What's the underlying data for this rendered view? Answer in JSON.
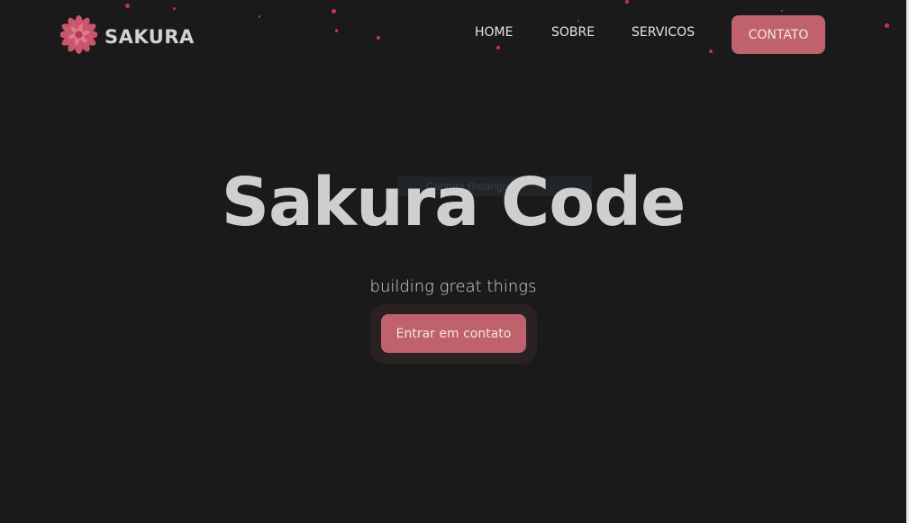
{
  "brand": {
    "name": "SAKURA",
    "logo_icon": "sakura-flower-icon",
    "accent": "#c0626e"
  },
  "nav": {
    "items": [
      {
        "label": "HOME"
      },
      {
        "label": "SOBRE"
      },
      {
        "label": "SERVICOS"
      }
    ],
    "contact_label": "CONTATO"
  },
  "hero": {
    "title": "Sakura Code",
    "subtitle": "building great things",
    "cta_label": "Entrar em contato"
  },
  "overlay": {
    "label": "Captura Retangu"
  },
  "colors": {
    "background": "#1a1a1a",
    "petal": "#c8354a",
    "button": "#c0626e",
    "text": "#cfcfcf"
  }
}
